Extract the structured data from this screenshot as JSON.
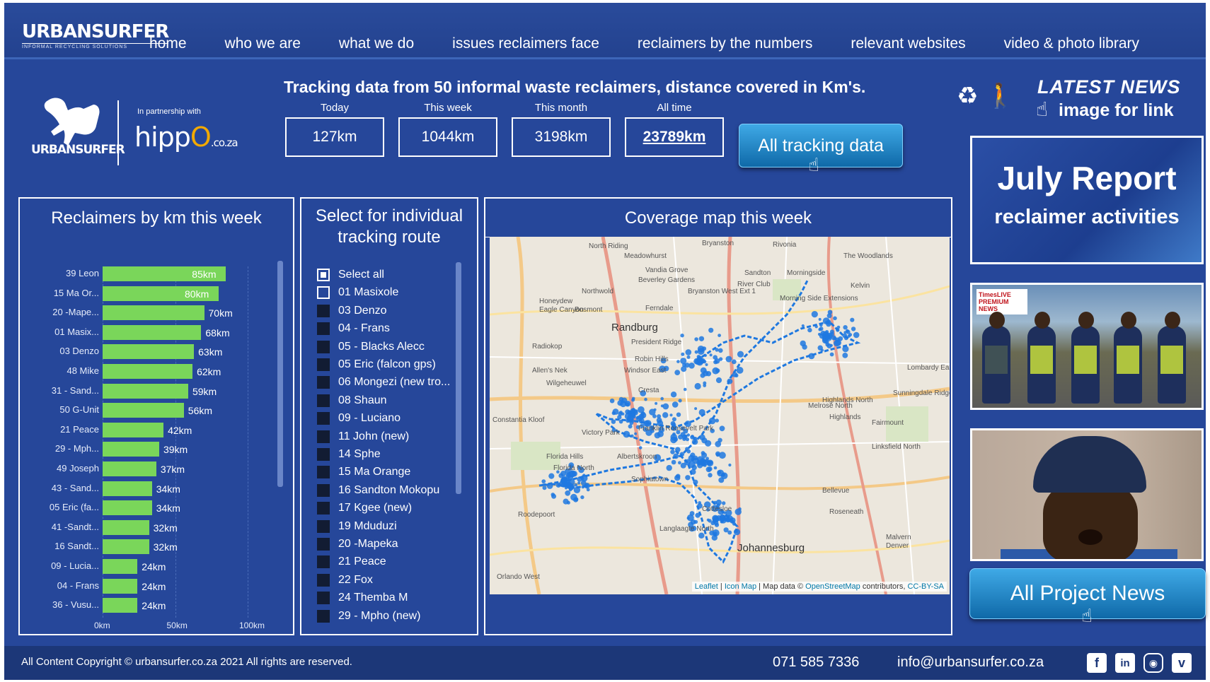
{
  "brand": {
    "name": "URBANSURFER",
    "tagline": "INFORMAL RECYCLING SOLUTIONS"
  },
  "nav": [
    "home",
    "who we are",
    "what we do",
    "issues reclaimers face",
    "reclaimers by the numbers",
    "relevant websites",
    "video & photo library"
  ],
  "partner": {
    "mascot_text": "URBANSURFER",
    "with_text": "In partnership with",
    "hippo_a": "hipp",
    "hippo_o": "O",
    "hippo_coza": ".co.za"
  },
  "tracking": {
    "title": "Tracking data from 50 informal waste reclaimers, distance covered in Km's.",
    "stats": [
      {
        "label": "Today",
        "value": "127km"
      },
      {
        "label": "This week",
        "value": "1044km"
      },
      {
        "label": "This month",
        "value": "3198km"
      },
      {
        "label": "All time",
        "value": "23789km"
      }
    ],
    "button": "All tracking data"
  },
  "news": {
    "latest": "LATEST NEWS",
    "image_link": "image for link",
    "report_title": "July Report",
    "report_sub": "reclaimer activities",
    "badge_line1": "TimesLIVE",
    "badge_line2": "PREMIUM",
    "badge_line3": "NEWS",
    "all_news": "All Project News"
  },
  "bar_panel": {
    "title": "Reclaimers by km this week"
  },
  "chart_data": {
    "type": "bar",
    "orientation": "horizontal",
    "title": "Reclaimers by km this week",
    "categories": [
      "39 Leon",
      "15 Ma Or...",
      "20 -Mape...",
      "01 Masix...",
      "03 Denzo",
      "48 Mike",
      "31 - Sand...",
      "50 G-Unit",
      "21 Peace",
      "29 - Mph...",
      "49 Joseph",
      "43 - Sand...",
      "05 Eric (fa...",
      "41 -Sandt...",
      "16 Sandt...",
      "09 - Lucia...",
      "04 - Frans",
      "36 - Vusu..."
    ],
    "values": [
      85,
      80,
      70,
      68,
      63,
      62,
      59,
      56,
      42,
      39,
      37,
      34,
      34,
      32,
      32,
      24,
      24,
      24
    ],
    "value_labels": [
      "85km",
      "80km",
      "70km",
      "68km",
      "63km",
      "62km",
      "59km",
      "56km",
      "42km",
      "39km",
      "37km",
      "34km",
      "34km",
      "32km",
      "32km",
      "24km",
      "24km",
      "24km"
    ],
    "xticks": [
      "0km",
      "50km",
      "100km"
    ],
    "xlim": [
      0,
      100
    ],
    "color": "#7ad65a"
  },
  "select_panel": {
    "title1": "Select for individual",
    "title2": "tracking route",
    "items": [
      {
        "label": "Select all",
        "state": "partial"
      },
      {
        "label": "01 Masixole",
        "state": "empty"
      },
      {
        "label": "03 Denzo",
        "state": "filled"
      },
      {
        "label": "04 - Frans",
        "state": "filled"
      },
      {
        "label": "05 - Blacks Alecc",
        "state": "filled"
      },
      {
        "label": "05 Eric (falcon gps)",
        "state": "filled"
      },
      {
        "label": "06 Mongezi (new tro...",
        "state": "filled"
      },
      {
        "label": "08 Shaun",
        "state": "filled"
      },
      {
        "label": "09 - Luciano",
        "state": "filled"
      },
      {
        "label": "11 John (new)",
        "state": "filled"
      },
      {
        "label": "14 Sphe",
        "state": "filled"
      },
      {
        "label": "15 Ma Orange",
        "state": "filled"
      },
      {
        "label": "16 Sandton Mokopu",
        "state": "filled"
      },
      {
        "label": "17 Kgee (new)",
        "state": "filled"
      },
      {
        "label": "19 Mduduzi",
        "state": "filled"
      },
      {
        "label": "20 -Mapeka",
        "state": "filled"
      },
      {
        "label": "21 Peace",
        "state": "filled"
      },
      {
        "label": "22 Fox",
        "state": "filled"
      },
      {
        "label": "24 Themba M",
        "state": "filled"
      },
      {
        "label": "29 - Mpho (new)",
        "state": "filled"
      }
    ]
  },
  "map_panel": {
    "title": "Coverage map this week",
    "labels": [
      "North Riding",
      "Bryanston",
      "Rivonia",
      "Meadowhurst",
      "The Woodlands",
      "Vandia Grove",
      "Sandton",
      "Morningside",
      "Beverley Gardens",
      "River Club",
      "Kelvin",
      "Northwold",
      "Bryanston West Ext 1",
      "Honeydew",
      "Morning Side Extensions",
      "Eagle Canyon",
      "Bosmont",
      "Ferndale",
      "Randburg",
      "President Ridge",
      "Radiokop",
      "Robin Hills",
      "Allen's Nek",
      "Windsor East",
      "Wilgeheuwel",
      "Cresta",
      "Highlands North",
      "Sunningdale Ridge",
      "Constantia Kloof",
      "Victory Park",
      "Franklin Roosevelt Park",
      "Albertskroon",
      "Florida Hills",
      "Florida North",
      "Sophiatown",
      "Linksfield North",
      "Roodepoort",
      "Cottesloe",
      "Bellevue",
      "Roseneath",
      "Langlaagte North",
      "Johannesburg",
      "Denver",
      "Malvern",
      "Orlando West",
      "Lombardy East",
      "Melrose North",
      "Highlands",
      "Fairmount"
    ],
    "city": "Randburg",
    "city2": "Johannesburg",
    "attrib_a": "Leaflet",
    "attrib_b": "Icon Map",
    "attrib_c": "Map data © ",
    "attrib_d": "OpenStreetMap",
    "attrib_e": " contributors, ",
    "attrib_f": "CC-BY-SA"
  },
  "footer": {
    "copyright": "All Content Copyright ©  urbansurfer.co.za   2021   All rights are reserved.",
    "phone": "071 585 7336",
    "email": "info@urbansurfer.co.za",
    "social": [
      "facebook-icon",
      "linkedin-icon",
      "instagram-icon",
      "vimeo-icon"
    ]
  },
  "colors": {
    "page_bg": "#26479a",
    "bar": "#7ad65a",
    "button": "#1a7cc0",
    "route": "#1e78e0"
  }
}
